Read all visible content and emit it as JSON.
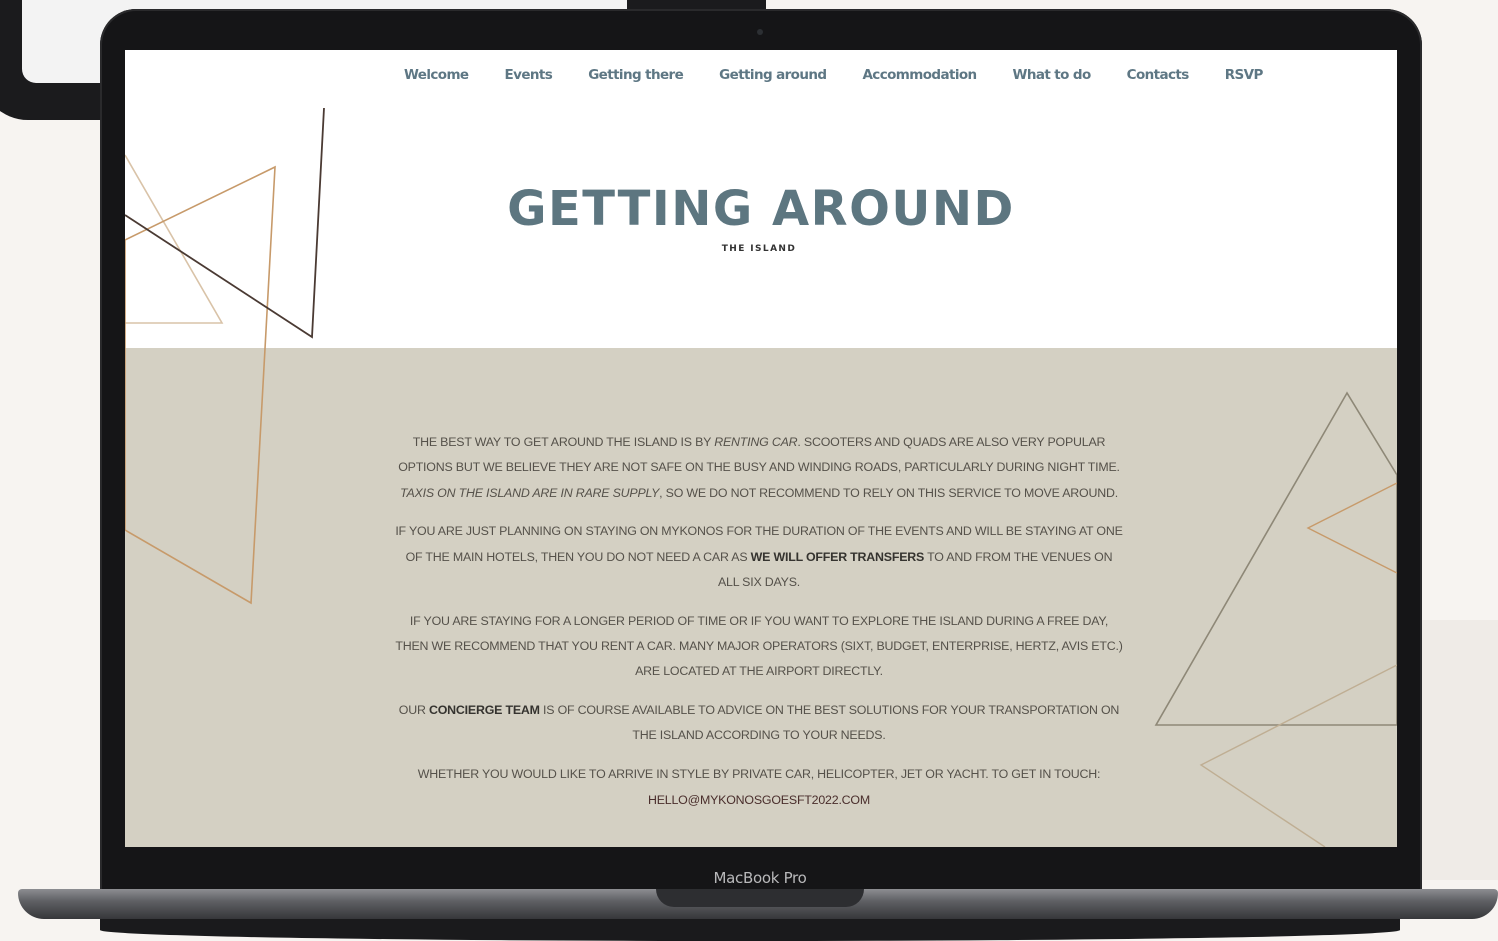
{
  "laptop": {
    "model_label": "MacBook Pro"
  },
  "nav": {
    "items": [
      "Welcome",
      "Events",
      "Getting there",
      "Getting around",
      "Accommodation",
      "What to do",
      "Contacts",
      "RSVP"
    ]
  },
  "hero": {
    "title": "GETTING AROUND",
    "subtitle": "THE ISLAND"
  },
  "content": {
    "p1": {
      "a": "THE BEST WAY TO GET AROUND THE ISLAND IS BY ",
      "em1": "RENTING CAR",
      "b": ". SCOOTERS AND QUADS ARE ALSO VERY POPULAR OPTIONS BUT WE BELIEVE THEY ARE NOT SAFE ON THE BUSY AND WINDING ROADS, PARTICULARLY DURING NIGHT TIME. ",
      "em2": "TAXIS ON THE ISLAND ARE IN RARE SUPPLY",
      "c": ", SO WE DO NOT RECOMMEND TO RELY ON THIS SERVICE TO MOVE AROUND."
    },
    "p2": {
      "a": "IF YOU ARE JUST PLANNING ON STAYING ON MYKONOS FOR THE DURATION OF THE EVENTS AND WILL BE STAYING AT ONE OF THE MAIN HOTELS, THEN YOU DO NOT NEED A CAR AS ",
      "strong": "WE WILL OFFER TRANSFERS",
      "b": " TO AND FROM THE VENUES ON ALL SIX DAYS."
    },
    "p3": "IF YOU ARE STAYING FOR A LONGER PERIOD OF TIME OR IF YOU WANT TO EXPLORE THE ISLAND DURING A FREE DAY, THEN WE RECOMMEND THAT YOU RENT A CAR. MANY MAJOR OPERATORS (SIXT, BUDGET, ENTERPRISE, HERTZ, AVIS ETC.) ARE LOCATED AT THE AIRPORT DIRECTLY.",
    "p4": {
      "a": "OUR ",
      "strong": "CONCIERGE TEAM",
      "b": " IS OF COURSE AVAILABLE TO ADVICE ON THE BEST SOLUTIONS FOR YOUR TRANSPORTATION ON THE ISLAND ACCORDING TO YOUR NEEDS."
    },
    "p5": {
      "a": "WHETHER YOU WOULD LIKE TO ARRIVE IN STYLE BY PRIVATE CAR, HELICOPTER, JET OR YACHT. TO GET IN TOUCH: ",
      "email": "HELLO@MYKONOSGOESFT2022.COM"
    }
  },
  "colors": {
    "accent": "#5d7680",
    "content_band": "#d4d0c3",
    "deco_gold": "#c79a6a",
    "deco_dark": "#4a3a33"
  }
}
